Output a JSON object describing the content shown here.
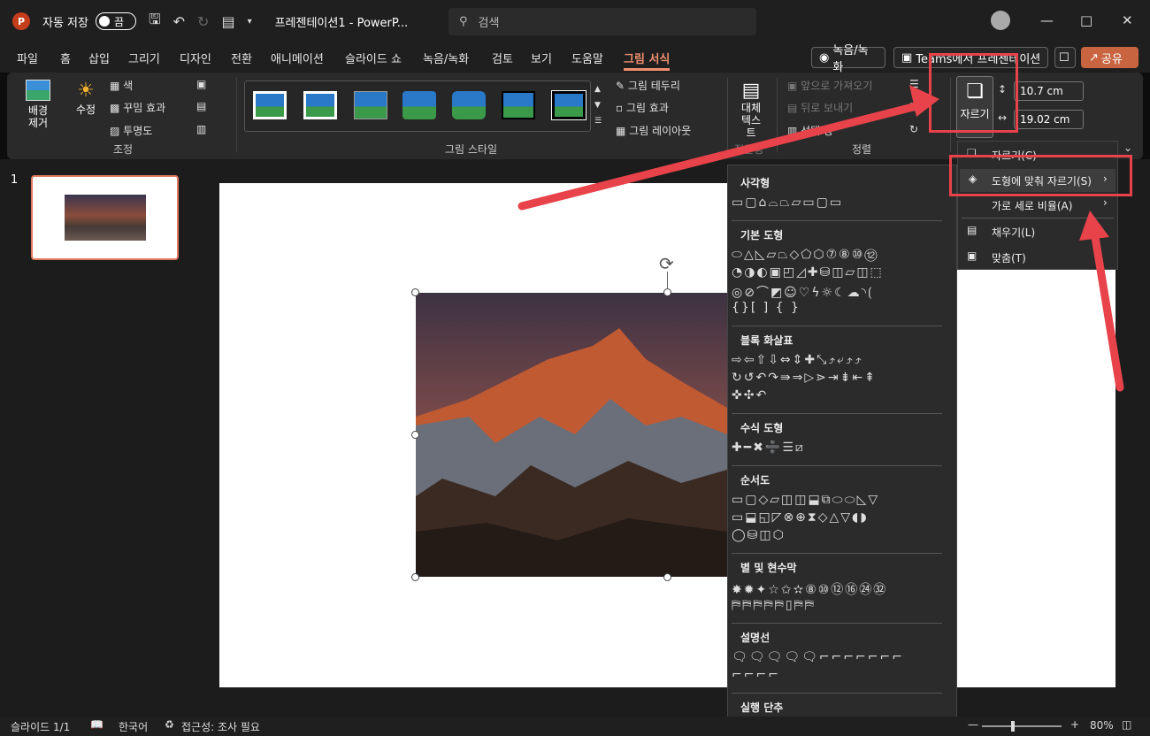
{
  "titlebar": {
    "autosave_label": "자동 저장",
    "toggle_label": "끔",
    "doc_title": "프레젠테이션1  -  PowerP...",
    "search_placeholder": "검색"
  },
  "tabs": [
    "파일",
    "홈",
    "삽입",
    "그리기",
    "디자인",
    "전환",
    "애니메이션",
    "슬라이드 쇼",
    "녹음/녹화",
    "검토",
    "보기",
    "도움말",
    "그림 서식"
  ],
  "tab_buttons": {
    "record": "녹음/녹화",
    "teams": "Teams에서 프레젠테이션",
    "share": "공유"
  },
  "ribbon": {
    "remove_bg": "배경 제거",
    "corrections": "수정",
    "color": "색",
    "artistic": "꾸밈 효과",
    "transparency": "투명도",
    "adjust_group": "조정",
    "styles_group": "그림 스타일",
    "border": "그림 테두리",
    "effects": "그림 효과",
    "layout": "그림 레이아웃",
    "alt_text": "대체 텍스트",
    "accessibility_group": "접근성",
    "bring_forward": "앞으로 가져오기",
    "send_backward": "뒤로 보내기",
    "selection_pane": "선택 창",
    "arrange_group": "정렬",
    "crop": "자르기",
    "height": "10.7 cm",
    "width": "19.02 cm"
  },
  "slides": {
    "number": "1"
  },
  "shape_menu": {
    "categories": [
      "사각형",
      "기본 도형",
      "블록 화살표",
      "수식 도형",
      "순서도",
      "별 및 현수막",
      "설명선",
      "실행 단추"
    ]
  },
  "crop_menu": {
    "items": [
      "자르기(C)",
      "도형에 맞춰 자르기(S)",
      "가로 세로 비율(A)",
      "채우기(L)",
      "맞춤(T)"
    ]
  },
  "statusbar": {
    "slide": "슬라이드 1/1",
    "language": "한국어",
    "accessibility": "접근성: 조사 필요",
    "zoom": "80%"
  },
  "colors": {
    "accent": "#f09070",
    "highlight": "#e8424a",
    "brand": "#c43e1c"
  }
}
